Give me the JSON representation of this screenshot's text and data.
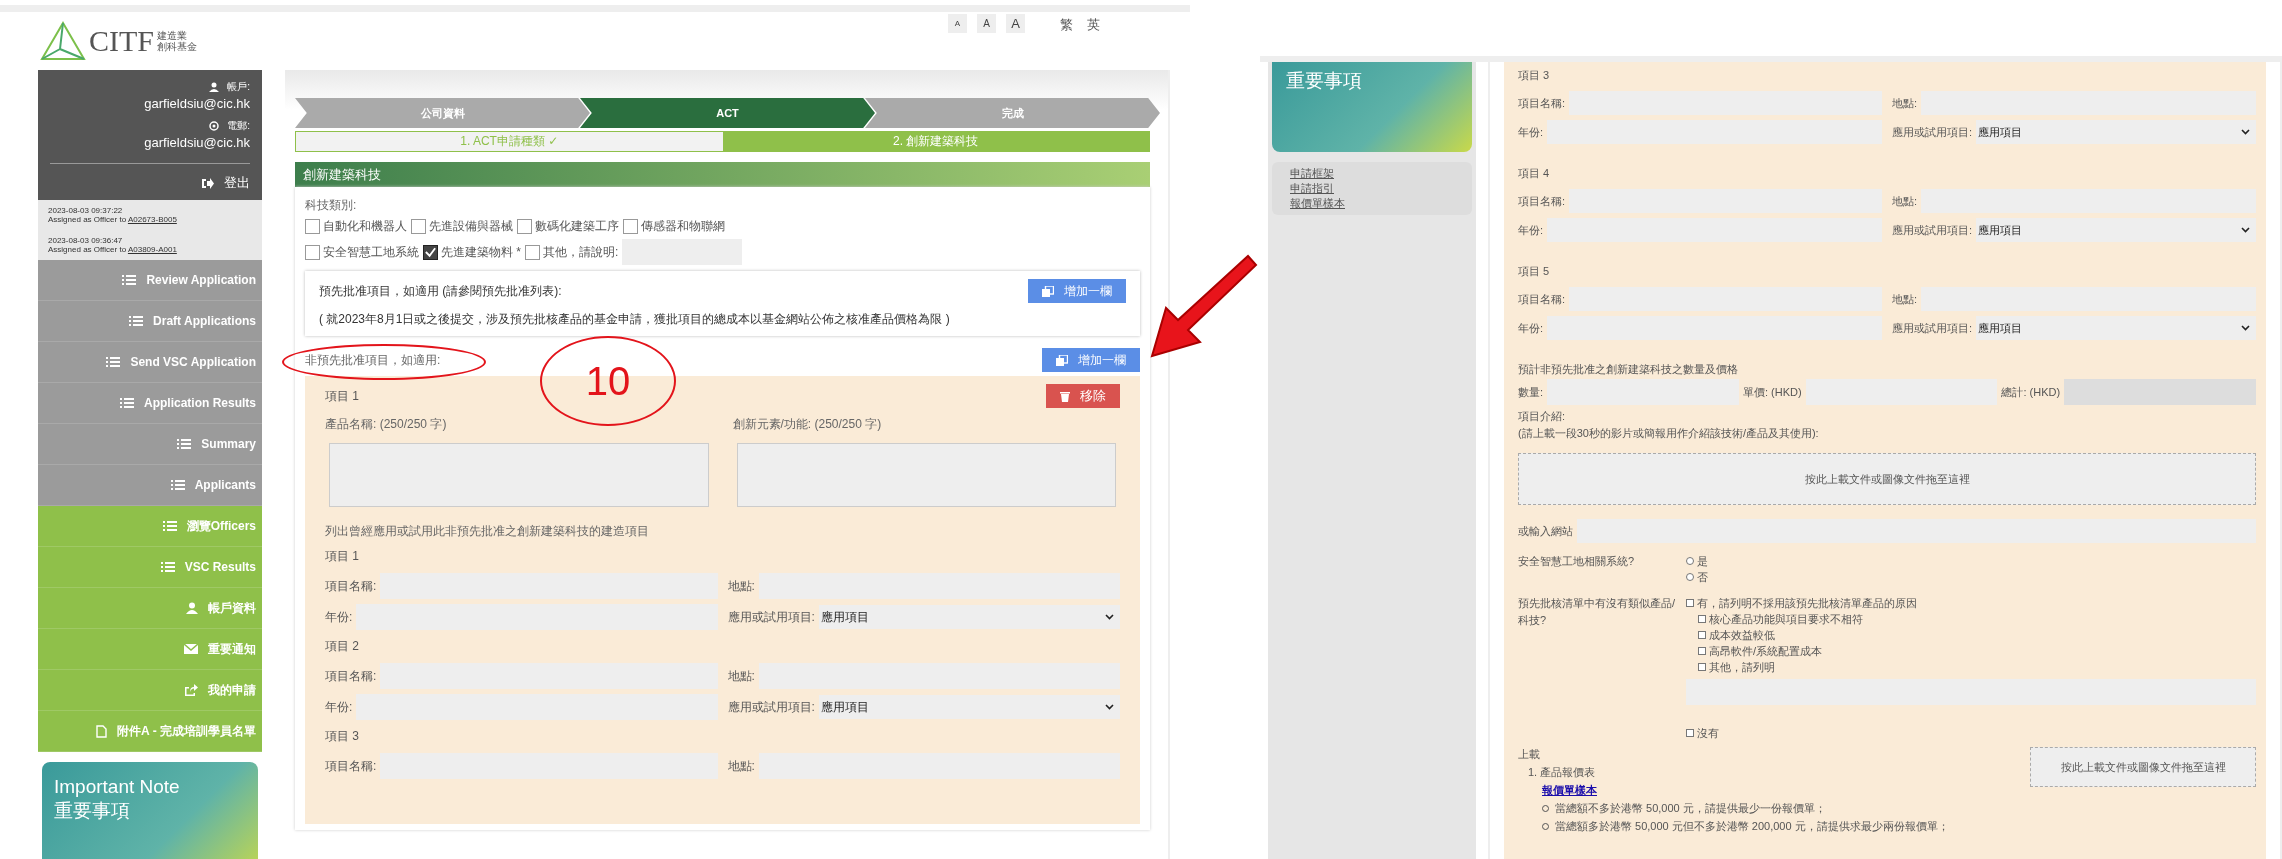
{
  "left": {
    "header": {
      "logo_text": "CITF",
      "logo_sub": [
        "建造業",
        "創科基金"
      ],
      "font_sizes": [
        "A",
        "A",
        "A"
      ],
      "languages": [
        "繁",
        "英"
      ]
    },
    "account": {
      "account_label": "帳戶:",
      "account": "garfieldsiu@cic.hk",
      "email_label": "電郵:",
      "email": "garfieldsiu@cic.hk",
      "logout": "登出"
    },
    "activity": [
      {
        "time": "2023-08-03 09:37:22",
        "text": "Assigned as Officer to",
        "link": "A02673-B005"
      },
      {
        "time": "2023-08-03 09:36:47",
        "text": "Assigned as Officer to",
        "link": "A03809-A001"
      }
    ],
    "menu": [
      {
        "label": "Review Application",
        "kind": "list",
        "color": "#9b9b9b"
      },
      {
        "label": "Draft Applications",
        "kind": "list",
        "color": "#9b9b9b"
      },
      {
        "label": "Send VSC Application",
        "kind": "list",
        "color": "#9b9b9b"
      },
      {
        "label": "Application Results",
        "kind": "list",
        "color": "#9b9b9b"
      },
      {
        "label": "Summary",
        "kind": "list",
        "color": "#9b9b9b"
      },
      {
        "label": "Applicants",
        "kind": "list",
        "color": "#9b9b9b"
      },
      {
        "label": "瀏覽Officers",
        "kind": "list",
        "color": "#8fc04a"
      },
      {
        "label": "VSC Results",
        "kind": "list",
        "color": "#8fc04a"
      },
      {
        "label": "帳戶資料",
        "kind": "user",
        "color": "#8fc04a"
      },
      {
        "label": "重要通知",
        "kind": "mail",
        "color": "#8fc04a"
      },
      {
        "label": "我的申請",
        "kind": "share",
        "color": "#8fc04a"
      },
      {
        "label": "附件A - 完成培訓學員名單",
        "kind": "file",
        "color": "#8fc04a"
      }
    ],
    "note_banner": {
      "title": "Important Note",
      "subtitle": "重要事項"
    },
    "steps": [
      {
        "label": "公司資料",
        "selected": false
      },
      {
        "label": "ACT",
        "selected": true
      },
      {
        "label": "完成",
        "selected": false
      }
    ],
    "substeps": [
      {
        "label": "1. ACT申請種類 ✓",
        "selected": false
      },
      {
        "label": "2. 創新建築科技",
        "selected": true
      }
    ],
    "section_title": "創新建築科技",
    "tech_label": "科技類別:",
    "tech_options": [
      {
        "label": "自動化和機器人",
        "checked": false
      },
      {
        "label": "先進設備與器械",
        "checked": false
      },
      {
        "label": "數碼化建築工序",
        "checked": false
      },
      {
        "label": "傳感器和物聯網",
        "checked": false
      },
      {
        "label": "安全智慧工地系統",
        "checked": false
      },
      {
        "label": "先進建築物料 *",
        "checked": true
      },
      {
        "label": "其他，請說明:",
        "checked": false
      }
    ],
    "preapproved": {
      "label": "預先批准項目，如適用 (請參閱預先批准列表):",
      "note": "( 就2023年8月1日或之後提交，涉及預先批核產品的基金申請，獲批項目的總成本以基金網站公佈之核准產品價格為限 )",
      "button": "增加一欄"
    },
    "non_preapproved": {
      "label": "非預先批准項目，如適用:",
      "button": "增加一欄",
      "item_title": "項目 1",
      "remove": "移除",
      "product_label": "產品名稱: (250/250 字)",
      "innovation_label": "創新元素/功能: (250/250 字)",
      "projects_intro": "列出曾經應用或試用此非預先批准之創新建築科技的建造項目",
      "projects": [
        {
          "title": "項目 1",
          "name_label": "項目名稱:",
          "location_label": "地點:",
          "year_label": "年份:",
          "usage_label": "應用或試用項目:",
          "usage_value": "應用項目"
        },
        {
          "title": "項目 2",
          "name_label": "項目名稱:",
          "location_label": "地點:",
          "year_label": "年份:",
          "usage_label": "應用或試用項目:",
          "usage_value": "應用項目"
        },
        {
          "title": "項目 3",
          "name_label": "項目名稱:",
          "location_label": "地點:"
        }
      ]
    },
    "callout_number": "10"
  },
  "right": {
    "note_banner_subtitle": "重要事項",
    "links": [
      "申請框架",
      "申請指引",
      "報價單樣本"
    ],
    "projects": [
      {
        "title": "項目 3",
        "name_label": "項目名稱:",
        "location_label": "地點:",
        "year_label": "年份:",
        "usage_label": "應用或試用項目:",
        "usage_value": "應用項目"
      },
      {
        "title": "項目 4",
        "name_label": "項目名稱:",
        "location_label": "地點:",
        "year_label": "年份:",
        "usage_label": "應用或試用項目:",
        "usage_value": "應用項目"
      },
      {
        "title": "項目 5",
        "name_label": "項目名稱:",
        "location_label": "地點:",
        "year_label": "年份:",
        "usage_label": "應用或試用項目:",
        "usage_value": "應用項目"
      }
    ],
    "quantity": {
      "title": "預計非預先批准之創新建築科技之數量及價格",
      "qty_label": "數量:",
      "unit_label": "單價: (HKD)",
      "total_label": "總計: (HKD)"
    },
    "intro": {
      "label": "項目介紹:",
      "hint": "(請上載一段30秒的影片或簡報用作介紹該技術/產品及其使用):",
      "upload": "按此上載文件或圖像文件拖至這裡"
    },
    "website_label": "或輸入網站",
    "smart_site": {
      "question": "安全智慧工地相關系統?",
      "options": [
        {
          "label": "是",
          "selected": false
        },
        {
          "label": "否",
          "selected": false
        }
      ]
    },
    "similar": {
      "question": "預先批核清單中有沒有類似產品/科技?",
      "yes": {
        "label": "有，請列明不採用該預先批核清單產品的原因",
        "checked": false
      },
      "reasons": [
        {
          "label": "核心產品功能與項目要求不相符",
          "checked": false
        },
        {
          "label": "成本效益較低",
          "checked": false
        },
        {
          "label": "高昂軟件/系統配置成本",
          "checked": false
        },
        {
          "label": "其他，請列明",
          "checked": false
        }
      ],
      "no": {
        "label": "沒有",
        "checked": false
      }
    },
    "upload": {
      "title": "上載",
      "number": "1.",
      "label": "產品報價表",
      "link": "報價單樣本",
      "notes": [
        "當總額不多於港幣 50,000 元，請提供最少一份報價單；",
        "當總額多於港幣 50,000 元但不多於港幣 200,000 元，請提供求最少兩份報價單；"
      ],
      "button": "按此上載文件或圖像文件拖至這裡"
    }
  }
}
